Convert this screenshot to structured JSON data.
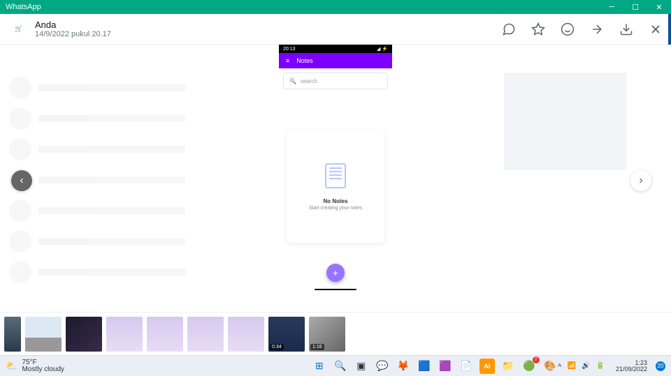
{
  "titlebar": {
    "app": "WhatsApp"
  },
  "header": {
    "name": "Anda",
    "date": "14/9/2022 pukul 20.17",
    "avatar": "🛒"
  },
  "phone": {
    "time": "20:13",
    "appbar": "Notes",
    "search": "search",
    "nonotes": "No Notes",
    "sub": "Start creating your notes"
  },
  "thumbs": {
    "t7": "0:34",
    "t8": "1:16"
  },
  "weather": {
    "temp": "75°F",
    "cond": "Mostly cloudy"
  },
  "clock": {
    "time": "1:23",
    "date": "21/09/2022"
  },
  "badge": "20",
  "wabadge": "7"
}
